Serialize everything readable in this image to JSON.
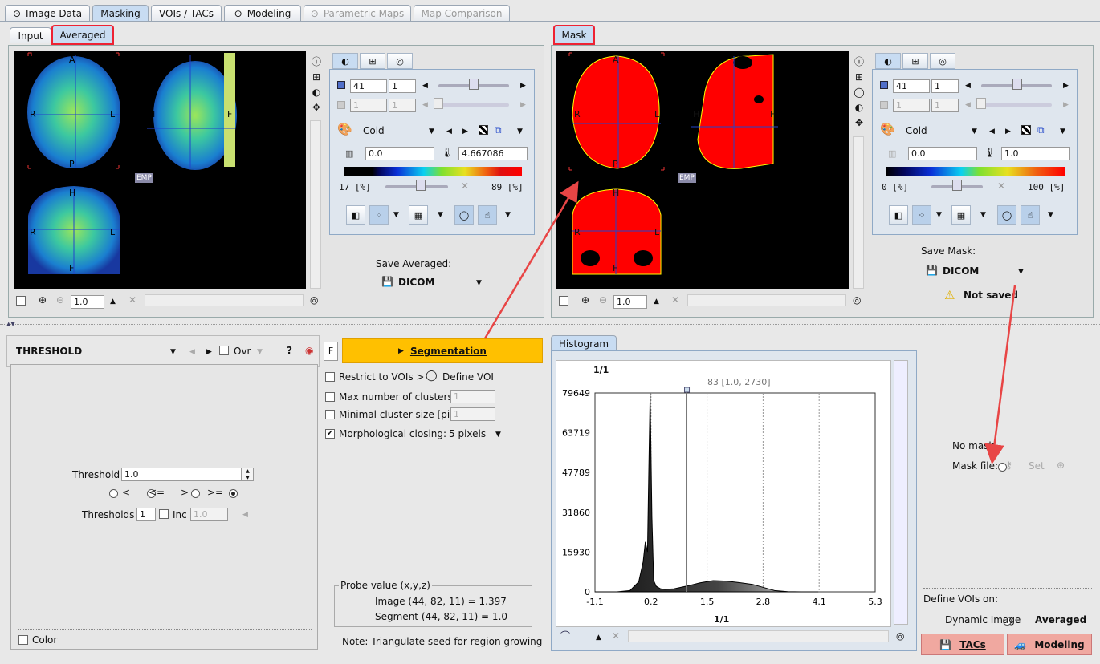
{
  "main_tabs": [
    "Image Data",
    "Masking",
    "VOIs / TACs",
    "Modeling",
    "Parametric Maps",
    "Map Comparison"
  ],
  "left_tabs": [
    "Input",
    "Averaged"
  ],
  "right_tab": "Mask",
  "orient": {
    "a": "A",
    "p": "P",
    "r": "R",
    "l": "L",
    "h": "H",
    "f": "F"
  },
  "emp": "EMP",
  "left_ctrl": {
    "frame": "41",
    "frame2": "1",
    "frame_b": "1",
    "frame2_b": "1",
    "lut": "Cold",
    "min": "0.0",
    "max": "4.667086",
    "pct_lo": "17 [%]",
    "pct_hi": "89 [%]",
    "save_label": "Save Averaged:",
    "save_fmt": "DICOM"
  },
  "right_ctrl": {
    "frame": "41",
    "frame2": "1",
    "frame_b": "1",
    "frame2_b": "1",
    "lut": "Cold",
    "min": "0.0",
    "max": "1.0",
    "pct_lo": "0 [%]",
    "pct_hi": "100 [%]",
    "save_label": "Save Mask:",
    "save_fmt": "DICOM",
    "status": "Not saved"
  },
  "zoom_left": "1.0",
  "zoom_right": "1.0",
  "method": "THRESHOLD",
  "ovr": "Ovr",
  "f_btn": "F",
  "help": "?",
  "segmentation": "Segmentation",
  "threshold": {
    "label": "Threshold",
    "value": "1.0",
    "ops": [
      "<",
      "<=",
      ">",
      ">="
    ],
    "thresholds_label": "Thresholds",
    "thresholds": "1",
    "inc": "Inc",
    "inc_val": "1.0"
  },
  "color_label": "Color",
  "options": {
    "restrict": "Restrict to VOIs >",
    "define_voi": "Define VOI",
    "max_clusters": "Max number of clusters",
    "max_clusters_val": "1",
    "min_cluster": "Minimal cluster size [pix]",
    "min_cluster_val": "1",
    "morph": "Morphological closing:",
    "morph_val": "5 pixels"
  },
  "probe": {
    "title": "Probe value (x,y,z)",
    "image": "Image (44, 82, 11) = 1.397",
    "segment": "Segment (44, 82, 11) = 1.0"
  },
  "note": "Note: Triangulate seed for region growing",
  "histogram": {
    "tab": "Histogram",
    "title": "1/1",
    "xlabel": "1/1",
    "marker": "83 [1.0, 2730]",
    "yticks": [
      "79649",
      "63719",
      "47789",
      "31860",
      "15930",
      "0"
    ],
    "xticks": [
      "-1.1",
      "0.2",
      "1.5",
      "2.8",
      "4.1",
      "5.3"
    ]
  },
  "mask_opts": {
    "no_mask": "No mask",
    "mask_file": "Mask file:",
    "set": "Set",
    "define_on": "Define VOIs on:",
    "dynamic": "Dynamic Image",
    "averaged": "Averaged"
  },
  "bottom_btns": {
    "tacs": "TACs",
    "modeling": "Modeling"
  },
  "chart_data": {
    "type": "area",
    "title": "1/1",
    "xlabel": "1/1",
    "ylabel": "",
    "xlim": [
      -1.1,
      5.3
    ],
    "ylim": [
      0,
      79649
    ],
    "x": [
      -1.1,
      -0.6,
      -0.3,
      -0.1,
      0.0,
      0.05,
      0.1,
      0.13,
      0.16,
      0.2,
      0.24,
      0.3,
      0.4,
      0.5,
      0.7,
      1.0,
      1.3,
      1.6,
      1.9,
      2.2,
      2.5,
      2.8,
      3.0,
      3.3,
      3.6,
      4.0
    ],
    "y": [
      0,
      0,
      500,
      4000,
      12000,
      20000,
      16000,
      50000,
      79649,
      30000,
      4500,
      2200,
      1200,
      1000,
      1200,
      2300,
      3600,
      4500,
      4300,
      3700,
      3000,
      1500,
      500,
      100,
      0,
      0
    ],
    "marker_x": 1.0
  }
}
